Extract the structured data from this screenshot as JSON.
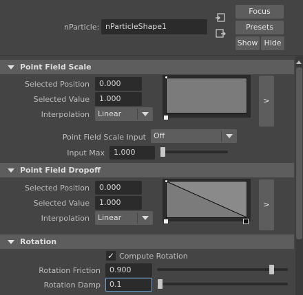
{
  "header": {
    "nparticle_label": "nParticle:",
    "nparticle_value": "nParticleShape1",
    "focus_label": "Focus",
    "presets_label": "Presets",
    "show_label": "Show",
    "hide_label": "Hide"
  },
  "point_field_scale": {
    "title": "Point Field Scale",
    "selected_position_label": "Selected Position",
    "selected_position_value": "0.000",
    "selected_value_label": "Selected Value",
    "selected_value_value": "1.000",
    "interpolation_label": "Interpolation",
    "interpolation_value": "Linear",
    "expand_label": ">",
    "input_label": "Point Field Scale Input",
    "input_value": "Off",
    "input_max_label": "Input Max",
    "input_max_value": "1.000",
    "input_max_slider_fraction": 0.0
  },
  "point_field_dropoff": {
    "title": "Point Field Dropoff",
    "selected_position_label": "Selected Position",
    "selected_position_value": "0.000",
    "selected_value_label": "Selected Value",
    "selected_value_value": "1.000",
    "interpolation_label": "Interpolation",
    "interpolation_value": "Linear",
    "expand_label": ">"
  },
  "rotation": {
    "title": "Rotation",
    "compute_rotation_label": "Compute Rotation",
    "compute_rotation_checked": true,
    "friction_label": "Rotation Friction",
    "friction_value": "0.900",
    "friction_slider_fraction": 0.9,
    "damp_label": "Rotation Damp",
    "damp_value": "0.1",
    "damp_slider_fraction": 0.0
  },
  "colors": {
    "background": "#444444",
    "field": "#2b2b2b",
    "button": "#5d5d5d",
    "ramp_fill": "#7b7b7b"
  }
}
